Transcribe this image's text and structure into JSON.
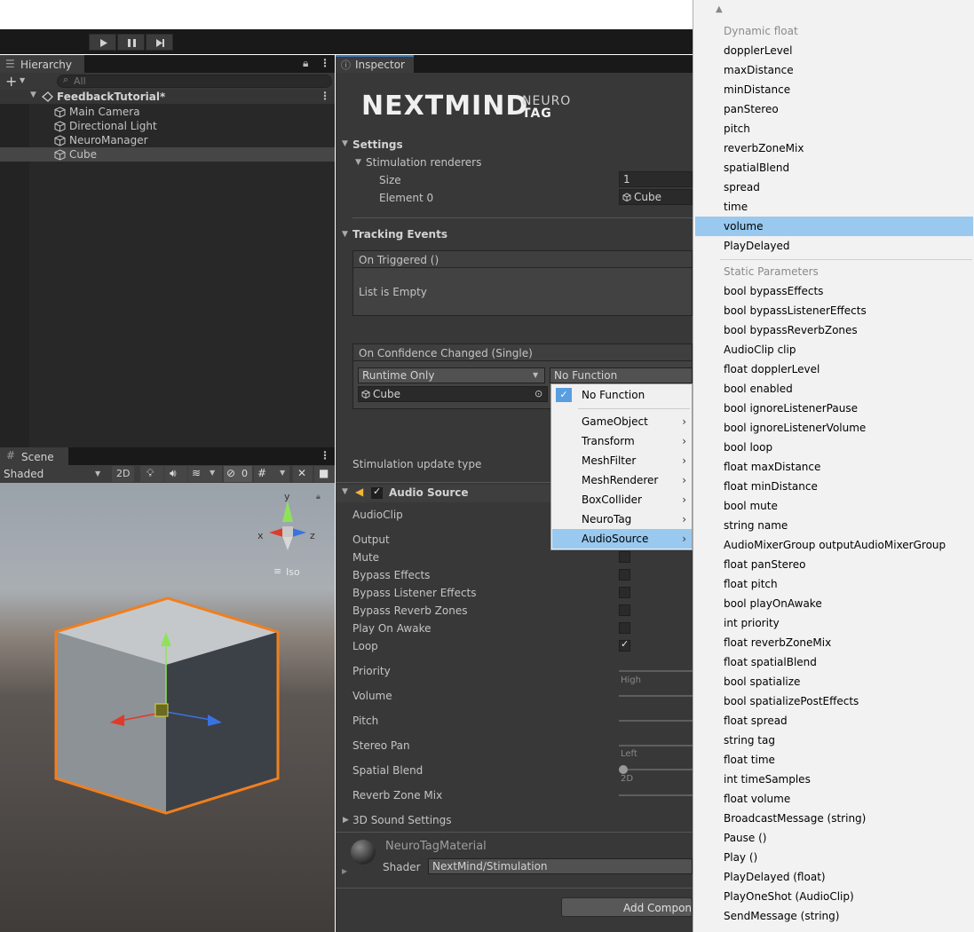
{
  "hierarchy": {
    "tab": "Hierarchy",
    "search_placeholder": "All",
    "scene_name": "FeedbackTutorial*",
    "items": [
      "Main Camera",
      "Directional Light",
      "NeuroManager",
      "Cube"
    ]
  },
  "scene": {
    "tab": "Scene",
    "shading": "Shaded",
    "mode_2d": "2D",
    "hidden_count": "0",
    "gizmo": {
      "y": "y",
      "x": "x",
      "z": "z",
      "iso": "Iso"
    }
  },
  "inspector": {
    "tab": "Inspector",
    "logo_main": "NEXTMIND",
    "logo_sub1": "NEURO",
    "logo_sub2": "TAG",
    "settings": {
      "title": "Settings",
      "stim_renderers": "Stimulation renderers",
      "size_label": "Size",
      "size_value": "1",
      "element0_label": "Element 0",
      "element0_value": "Cube"
    },
    "tracking": {
      "title": "Tracking Events",
      "on_triggered": "On Triggered ()",
      "list_empty": "List is Empty",
      "on_confidence": "On Confidence Changed (Single)",
      "runtime": "Runtime Only",
      "function": "No Function",
      "object": "Cube"
    },
    "stim_update": "Stimulation update type",
    "audio": {
      "title": "Audio Source",
      "labels": [
        "AudioClip",
        "Output",
        "Mute",
        "Bypass Effects",
        "Bypass Listener Effects",
        "Bypass Reverb Zones",
        "Play On Awake",
        "Loop",
        "Priority",
        "Volume",
        "Pitch",
        "Stereo Pan",
        "Spatial Blend",
        "Reverb Zone Mix"
      ],
      "priority_hint": "High",
      "stereo_hint": "Left",
      "spatial_hint": "2D",
      "sound3d": "3D Sound Settings"
    },
    "material": {
      "name": "NeuroTagMaterial",
      "shader_label": "Shader",
      "shader_value": "NextMind/Stimulation"
    },
    "add_component": "Add Component"
  },
  "context_menu": {
    "items": [
      "No Function",
      "GameObject",
      "Transform",
      "MeshFilter",
      "MeshRenderer",
      "BoxCollider",
      "NeuroTag",
      "AudioSource"
    ]
  },
  "dropdown": {
    "dynamic_header": "Dynamic float",
    "dynamic_items": [
      "dopplerLevel",
      "maxDistance",
      "minDistance",
      "panStereo",
      "pitch",
      "reverbZoneMix",
      "spatialBlend",
      "spread",
      "time",
      "volume",
      "PlayDelayed"
    ],
    "static_header": "Static Parameters",
    "static_items": [
      "bool bypassEffects",
      "bool bypassListenerEffects",
      "bool bypassReverbZones",
      "AudioClip clip",
      "float dopplerLevel",
      "bool enabled",
      "bool ignoreListenerPause",
      "bool ignoreListenerVolume",
      "bool loop",
      "float maxDistance",
      "float minDistance",
      "bool mute",
      "string name",
      "AudioMixerGroup outputAudioMixerGroup",
      "float panStereo",
      "float pitch",
      "bool playOnAwake",
      "int priority",
      "float reverbZoneMix",
      "float spatialBlend",
      "bool spatialize",
      "bool spatializePostEffects",
      "float spread",
      "string tag",
      "float time",
      "int timeSamples",
      "float volume",
      "BroadcastMessage (string)",
      "Pause ()",
      "Play ()",
      "PlayDelayed (float)",
      "PlayOneShot (AudioClip)",
      "SendMessage (string)"
    ]
  },
  "colors": {
    "selection": "#99c9ef",
    "accent": "#3a79bb",
    "orange_outline": "#f07f1e"
  }
}
